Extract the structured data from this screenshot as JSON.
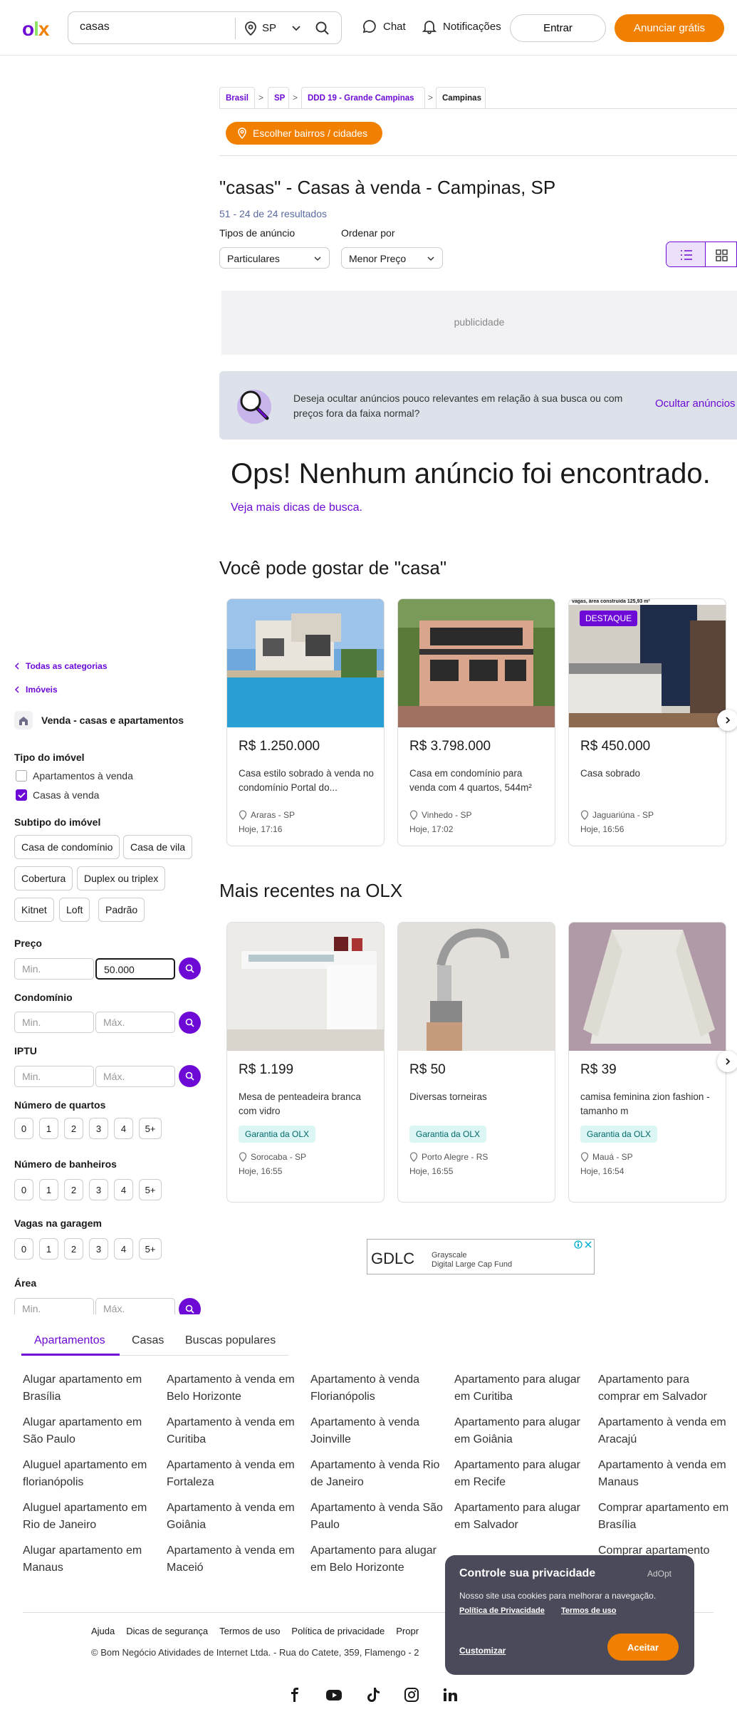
{
  "header": {
    "logo": {
      "o": "o",
      "l": "l",
      "x": "x"
    },
    "search_value": "casas",
    "state": "SP",
    "chat": "Chat",
    "notifications": "Notificações",
    "login": "Entrar",
    "post_ad": "Anunciar grátis"
  },
  "breadcrumb": [
    "Brasil",
    "SP",
    "DDD 19 - Grande Campinas",
    "Campinas"
  ],
  "choose_neighborhoods": "Escolher bairros / cidades",
  "page_title": "\"casas\" - Casas à venda - Campinas, SP",
  "result_count": "51 - 24 de 24 resultados",
  "filters_top": {
    "ad_type_label": "Tipos de anúncio",
    "ad_type_value": "Particulares",
    "sort_label": "Ordenar por",
    "sort_value": "Menor Preço"
  },
  "ad_placeholder": "publicidade",
  "hide_banner": {
    "text": "Deseja ocultar anúncios pouco relevantes em relação à sua busca ou com preços fora da faixa normal?",
    "link": "Ocultar anúncios"
  },
  "empty": {
    "title": "Ops! Nenhum anúncio foi encontrado.",
    "tips": "Veja mais dicas de busca."
  },
  "suggest_title": "Você pode gostar de \"casa\"",
  "suggest_cards": [
    {
      "price": "R$ 1.250.000",
      "title": "Casa estilo sobrado à venda no condomínio Portal do...",
      "location": "Araras - SP",
      "date": "Hoje, 17:16"
    },
    {
      "price": "R$ 3.798.000",
      "title": "Casa em condomínio para venda com 4 quartos, 544m²",
      "location": "Vinhedo - SP",
      "date": "Hoje, 17:02"
    },
    {
      "price": "R$ 450.000",
      "title": "Casa sobrado",
      "location": "Jaguariúna - SP",
      "date": "Hoje, 16:56",
      "badge": "DESTAQUE",
      "image_caption": "vagas, área construída 125,93 m²"
    }
  ],
  "recent_title": "Mais recentes na OLX",
  "recent_cards": [
    {
      "price": "R$ 1.199",
      "title": "Mesa de penteadeira branca com vidro",
      "tag": "Garantia da OLX",
      "location": "Sorocaba - SP",
      "date": "Hoje, 16:55"
    },
    {
      "price": "R$ 50",
      "title": "Diversas torneiras",
      "tag": "Garantia da OLX",
      "location": "Porto Alegre - RS",
      "date": "Hoje, 16:55"
    },
    {
      "price": "R$ 39",
      "title": "camisa feminina zion fashion - tamanho m",
      "tag": "Garantia da OLX",
      "location": "Mauá - SP",
      "date": "Hoje, 16:54"
    }
  ],
  "sidebar": {
    "all_categories": "Todas as categorias",
    "imoveis": "Imóveis",
    "category": "Venda - casas e apartamentos",
    "tipo_label": "Tipo do imóvel",
    "tipo_options": [
      {
        "label": "Apartamentos à venda",
        "checked": false
      },
      {
        "label": "Casas à venda",
        "checked": true
      }
    ],
    "subtipo_label": "Subtipo do imóvel",
    "subtipos": [
      "Casa de condomínio",
      "Casa de vila",
      "Cobertura",
      "Duplex ou triplex",
      "Kitnet",
      "Loft",
      "Padrão"
    ],
    "preco_label": "Preço",
    "min": "Min.",
    "max": "Máx.",
    "preco_max_value": "50.000",
    "condominio_label": "Condomínio",
    "iptu_label": "IPTU",
    "quartos_label": "Número de quartos",
    "banheiros_label": "Número de banheiros",
    "vagas_label": "Vagas na garagem",
    "area_label": "Área",
    "counts": [
      "0",
      "1",
      "2",
      "3",
      "4",
      "5+"
    ]
  },
  "ad_banner": {
    "brand": "GDLC",
    "line1": "Grayscale",
    "line2": "Digital Large Cap Fund"
  },
  "footer_tabs": [
    "Apartamentos",
    "Casas",
    "Buscas populares"
  ],
  "footer_links": [
    [
      "Alugar apartamento em Brasília",
      "Alugar apartamento em São Paulo",
      "Aluguel apartamento em florianópolis",
      "Aluguel apartamento em Rio de Janeiro",
      "Alugar apartamento em Manaus"
    ],
    [
      "Apartamento à venda em Belo Horizonte",
      "Apartamento à venda em Curitiba",
      "Apartamento à venda em Fortaleza",
      "Apartamento à venda em Goiânia",
      "Apartamento à venda em Maceió"
    ],
    [
      "Apartamento à venda Florianópolis",
      "Apartamento à venda Joinville",
      "Apartamento à venda Rio de Janeiro",
      "Apartamento à venda São Paulo",
      "Apartamento para alugar em Belo Horizonte"
    ],
    [
      "Apartamento para alugar em Curitiba",
      "Apartamento para alugar em Goiânia",
      "Apartamento para alugar em Recife",
      "Apartamento para alugar em Salvador"
    ],
    [
      "Apartamento para comprar em Salvador",
      "Apartamento à venda em Aracajú",
      "Apartamento à venda em Manaus",
      "Comprar apartamento em Brasília",
      "Comprar apartamento"
    ]
  ],
  "bottom_links": [
    "Ajuda",
    "Dicas de segurança",
    "Termos de uso",
    "Política de privacidade",
    "Propr"
  ],
  "copyright": "© Bom Negócio Atividades de Internet Ltda. - Rua do Catete, 359, Flamengo - 2",
  "privacy": {
    "title": "Controle sua privacidade",
    "brand": "AdOpt",
    "text": "Nosso site usa cookies para melhorar a navegação.",
    "policy_link": "Política de Privacidade",
    "terms_link": "Termos de uso",
    "customize": "Customizar",
    "accept": "Aceitar"
  },
  "colors": {
    "brand_purple": "#6e0ad6",
    "brand_orange": "#f28000",
    "brand_green": "#8ce563"
  }
}
